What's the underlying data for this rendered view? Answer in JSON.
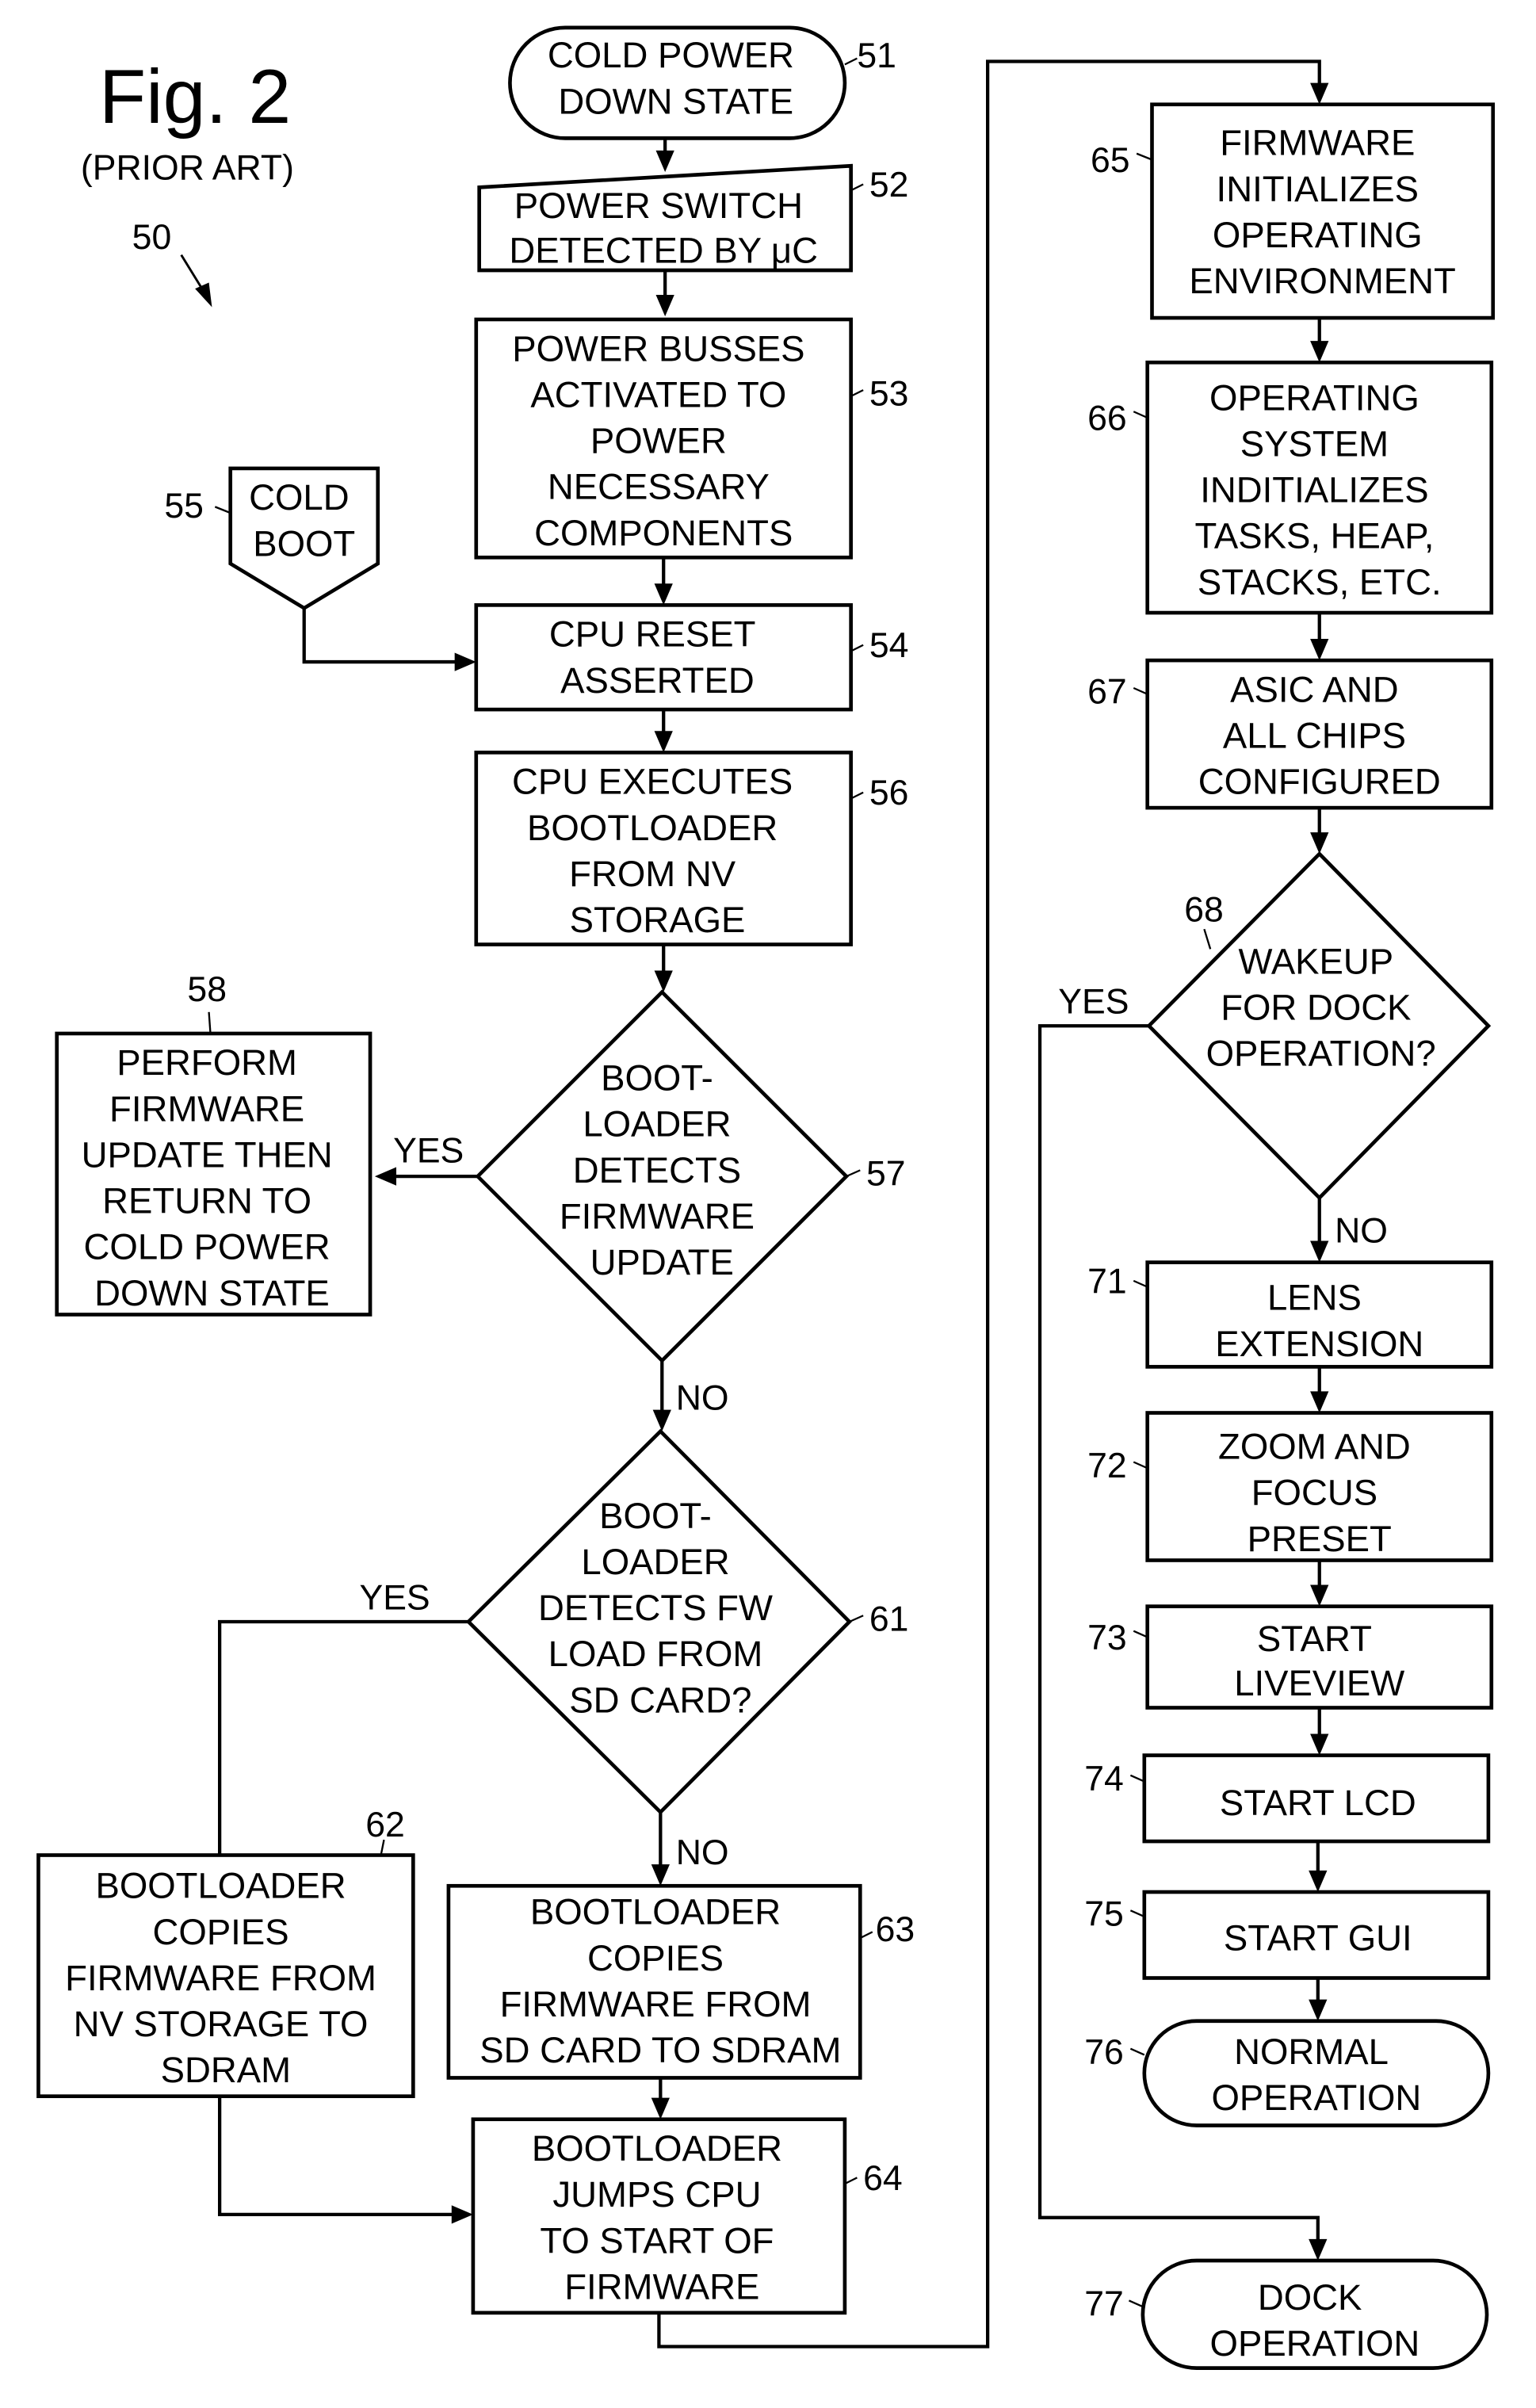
{
  "figure": {
    "title": "Fig. 2",
    "subtitle": "(PRIOR ART)",
    "ref": "50"
  },
  "branch_labels": {
    "yes": "YES",
    "no": "NO"
  },
  "nodes": {
    "n51": {
      "ref": "51",
      "shape": "terminator",
      "lines": [
        "COLD POWER",
        "DOWN STATE"
      ]
    },
    "n52": {
      "ref": "52",
      "shape": "manual-input",
      "lines": [
        "POWER SWITCH",
        "DETECTED BY μC"
      ]
    },
    "n53": {
      "ref": "53",
      "shape": "process",
      "lines": [
        "POWER BUSSES",
        "ACTIVATED TO",
        "POWER",
        "NECESSARY",
        "COMPONENTS"
      ]
    },
    "n55": {
      "ref": "55",
      "shape": "off-page-connector",
      "lines": [
        "COLD",
        "BOOT"
      ]
    },
    "n54": {
      "ref": "54",
      "shape": "process",
      "lines": [
        "CPU RESET",
        "ASSERTED"
      ]
    },
    "n56": {
      "ref": "56",
      "shape": "process",
      "lines": [
        "CPU EXECUTES",
        "BOOTLOADER",
        "FROM NV",
        "STORAGE"
      ]
    },
    "n57": {
      "ref": "57",
      "shape": "decision",
      "lines": [
        "BOOT-",
        "LOADER",
        "DETECTS",
        "FIRMWARE",
        "UPDATE"
      ]
    },
    "n58": {
      "ref": "58",
      "shape": "process",
      "lines": [
        "PERFORM",
        "FIRMWARE",
        "UPDATE THEN",
        "RETURN TO",
        "COLD POWER",
        "DOWN STATE"
      ]
    },
    "n61": {
      "ref": "61",
      "shape": "decision",
      "lines": [
        "BOOT-",
        "LOADER",
        "DETECTS FW",
        "LOAD FROM",
        "SD CARD?"
      ]
    },
    "n62": {
      "ref": "62",
      "shape": "process",
      "lines": [
        "BOOTLOADER",
        "COPIES",
        "FIRMWARE FROM",
        "NV STORAGE TO",
        "SDRAM"
      ]
    },
    "n63": {
      "ref": "63",
      "shape": "process",
      "lines": [
        "BOOTLOADER",
        "COPIES",
        "FIRMWARE FROM",
        "SD CARD TO SDRAM"
      ]
    },
    "n64": {
      "ref": "64",
      "shape": "process",
      "lines": [
        "BOOTLOADER",
        "JUMPS CPU",
        "TO START OF",
        "FIRMWARE"
      ]
    },
    "n65": {
      "ref": "65",
      "shape": "process",
      "lines": [
        "FIRMWARE",
        "INITIALIZES",
        "OPERATING",
        "ENVIRONMENT"
      ]
    },
    "n66": {
      "ref": "66",
      "shape": "process",
      "lines": [
        "OPERATING",
        "SYSTEM",
        "INDITIALIZES",
        "TASKS, HEAP,",
        "STACKS, ETC."
      ]
    },
    "n67": {
      "ref": "67",
      "shape": "process",
      "lines": [
        "ASIC AND",
        "ALL CHIPS",
        "CONFIGURED"
      ]
    },
    "n68": {
      "ref": "68",
      "shape": "decision",
      "lines": [
        "WAKEUP",
        "FOR DOCK",
        "OPERATION?"
      ]
    },
    "n71": {
      "ref": "71",
      "shape": "process",
      "lines": [
        "LENS",
        "EXTENSION"
      ]
    },
    "n72": {
      "ref": "72",
      "shape": "process",
      "lines": [
        "ZOOM AND",
        "FOCUS",
        "PRESET"
      ]
    },
    "n73": {
      "ref": "73",
      "shape": "process",
      "lines": [
        "START",
        "LIVEVIEW"
      ]
    },
    "n74": {
      "ref": "74",
      "shape": "process",
      "lines": [
        "START LCD"
      ]
    },
    "n75": {
      "ref": "75",
      "shape": "process",
      "lines": [
        "START GUI"
      ]
    },
    "n76": {
      "ref": "76",
      "shape": "terminator",
      "lines": [
        "NORMAL",
        "OPERATION"
      ]
    },
    "n77": {
      "ref": "77",
      "shape": "terminator",
      "lines": [
        "DOCK",
        "OPERATION"
      ]
    }
  },
  "edges": [
    {
      "from": "51",
      "to": "52",
      "label": ""
    },
    {
      "from": "52",
      "to": "53",
      "label": ""
    },
    {
      "from": "53",
      "to": "54",
      "label": ""
    },
    {
      "from": "55",
      "to": "54",
      "label": ""
    },
    {
      "from": "54",
      "to": "56",
      "label": ""
    },
    {
      "from": "56",
      "to": "57",
      "label": ""
    },
    {
      "from": "57",
      "to": "58",
      "label": "YES"
    },
    {
      "from": "57",
      "to": "61",
      "label": "NO"
    },
    {
      "from": "61",
      "to": "62",
      "label": "YES"
    },
    {
      "from": "61",
      "to": "63",
      "label": "NO"
    },
    {
      "from": "62",
      "to": "64",
      "label": ""
    },
    {
      "from": "63",
      "to": "64",
      "label": ""
    },
    {
      "from": "64",
      "to": "65",
      "label": ""
    },
    {
      "from": "65",
      "to": "66",
      "label": ""
    },
    {
      "from": "66",
      "to": "67",
      "label": ""
    },
    {
      "from": "67",
      "to": "68",
      "label": ""
    },
    {
      "from": "68",
      "to": "77",
      "label": "YES"
    },
    {
      "from": "68",
      "to": "71",
      "label": "NO"
    },
    {
      "from": "71",
      "to": "72",
      "label": ""
    },
    {
      "from": "72",
      "to": "73",
      "label": ""
    },
    {
      "from": "73",
      "to": "74",
      "label": ""
    },
    {
      "from": "74",
      "to": "75",
      "label": ""
    },
    {
      "from": "75",
      "to": "76",
      "label": ""
    }
  ]
}
